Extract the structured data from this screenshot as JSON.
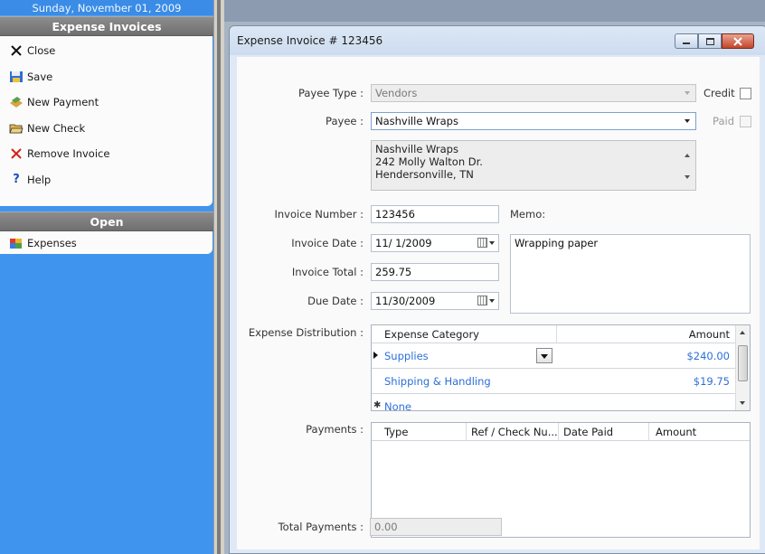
{
  "nav": {
    "date": "Sunday, November 01, 2009",
    "section_title": "Expense Invoices",
    "tasks": [
      {
        "label": "Close",
        "icon": "close-x-icon"
      },
      {
        "label": "Save",
        "icon": "save-disk-icon"
      },
      {
        "label": "New Payment",
        "icon": "money-icon"
      },
      {
        "label": "New Check",
        "icon": "open-folder-icon"
      },
      {
        "label": "Remove Invoice",
        "icon": "remove-x-icon"
      },
      {
        "label": "Help",
        "icon": "help-icon"
      }
    ],
    "open_title": "Open",
    "open_items": [
      {
        "label": "Expenses",
        "icon": "chart-icon"
      }
    ]
  },
  "window": {
    "title": "Expense Invoice # 123456",
    "buttons": [
      "minimize",
      "maximize",
      "close"
    ]
  },
  "form": {
    "payee_type_label": "Payee Type :",
    "payee_type_value": "Vendors",
    "credit_label": "Credit",
    "payee_label": "Payee :",
    "payee_value": "Nashville Wraps",
    "paid_label": "Paid",
    "address_lines": [
      "Nashville Wraps",
      "242 Molly Walton Dr.",
      "Hendersonville, TN"
    ],
    "invoice_number_label": "Invoice Number :",
    "invoice_number_value": "123456",
    "memo_label": "Memo:",
    "memo_value": "Wrapping paper",
    "invoice_date_label": "Invoice Date :",
    "invoice_date_value": "11/ 1/2009",
    "invoice_total_label": "Invoice Total :",
    "invoice_total_value": "259.75",
    "due_date_label": "Due Date :",
    "due_date_value": "11/30/2009",
    "expense_distribution_label": "Expense Distribution :",
    "distribution_headers": [
      "Expense Category",
      "Amount"
    ],
    "distribution_rows": [
      {
        "category": "Supplies",
        "amount": "$240.00"
      },
      {
        "category": "Shipping & Handling",
        "amount": "$19.75"
      }
    ],
    "distribution_new_row": "None",
    "payments_label": "Payments :",
    "payments_headers": [
      "Type",
      "Ref / Check Nu...",
      "Date Paid",
      "Amount"
    ],
    "total_payments_label": "Total Payments :",
    "total_payments_value": "0.00"
  },
  "colors": {
    "nav_bg": "#3f94ee",
    "header_gray": "#7f7f7f",
    "link_blue": "#2c6fd8",
    "close_red": "#c4452a"
  }
}
